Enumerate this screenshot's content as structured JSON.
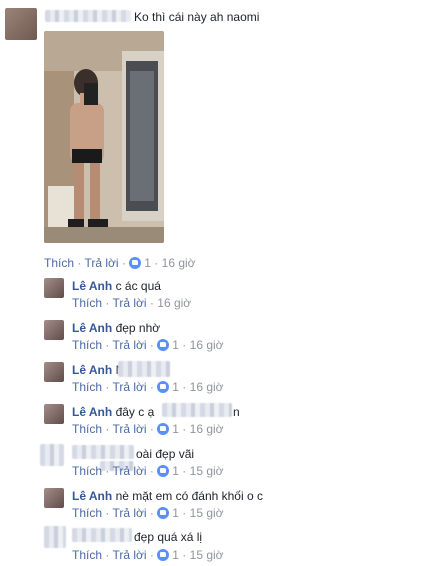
{
  "main_comment": {
    "text": "Ko thì cái này ah naomi",
    "actions": {
      "like": "Thích",
      "reply": "Trả lời",
      "likes": "1",
      "time": "16 giờ"
    }
  },
  "replies": [
    {
      "name": "Lê Anh",
      "text": "c ác quá",
      "like": "Thích",
      "reply": "Trả lời",
      "likes": "",
      "time": "16 giờ"
    },
    {
      "name": "Lê Anh",
      "text": "đẹp nhờ",
      "like": "Thích",
      "reply": "Trả lời",
      "likes": "1",
      "time": "16 giờ"
    },
    {
      "name": "Lê Anh",
      "text": "N",
      "like": "Thích",
      "reply": "Trả lời",
      "likes": "1",
      "time": "16 giờ"
    },
    {
      "name": "Lê Anh",
      "text": "đây c ạ",
      "text_after": "n",
      "like": "Thích",
      "reply": "Trả lời",
      "likes": "1",
      "time": "16 giờ"
    },
    {
      "name": "",
      "text": "oài đẹp vãi",
      "like": "Thích",
      "reply": "Trả lời",
      "likes": "1",
      "time": "15 giờ"
    },
    {
      "name": "Lê Anh",
      "text": "nè mặt em có đánh khối o c",
      "like": "Thích",
      "reply": "Trả lời",
      "likes": "1",
      "time": "15 giờ"
    },
    {
      "name": "",
      "text": "đẹp quá xá lị",
      "like": "Thích",
      "reply": "Trả lời",
      "likes": "1",
      "time": "15 giờ"
    }
  ],
  "separator": "·",
  "colors": {
    "name": "#365899",
    "action": "#4b6aa5",
    "meta": "#90949c",
    "like_badge": "#5890ff"
  },
  "icons": {
    "like": "thumbs-up-icon"
  }
}
